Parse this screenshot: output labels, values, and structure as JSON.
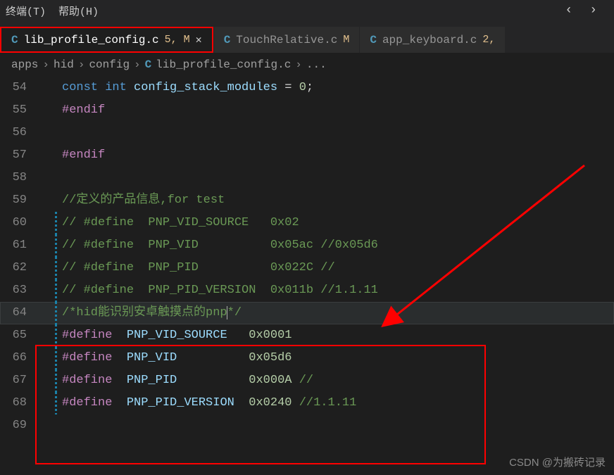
{
  "menu": {
    "terminal": "终端(T)",
    "help": "帮助(H)"
  },
  "tabs": [
    {
      "file": "lib_profile_config.c",
      "badge": "5, M",
      "active": true,
      "closable": true
    },
    {
      "file": "TouchRelative.c",
      "badge": "M",
      "active": false,
      "closable": false
    },
    {
      "file": "app_keyboard.c",
      "badge": "2,",
      "active": false,
      "closable": false
    }
  ],
  "breadcrumbs": {
    "parts": [
      "apps",
      "hid",
      "config"
    ],
    "file": "lib_profile_config.c",
    "tail": "..."
  },
  "lines": [
    {
      "n": "54",
      "mod": false,
      "seg": [
        {
          "c": "kw-const",
          "t": "const "
        },
        {
          "c": "kw-int",
          "t": "int "
        },
        {
          "c": "varname",
          "t": "config_stack_modules"
        },
        {
          "c": "plain",
          "t": " = "
        },
        {
          "c": "num",
          "t": "0"
        },
        {
          "c": "plain",
          "t": ";"
        }
      ]
    },
    {
      "n": "55",
      "mod": false,
      "seg": [
        {
          "c": "kw-pre",
          "t": "#endif"
        }
      ]
    },
    {
      "n": "56",
      "mod": false,
      "seg": []
    },
    {
      "n": "57",
      "mod": false,
      "seg": [
        {
          "c": "kw-pre",
          "t": "#endif"
        }
      ]
    },
    {
      "n": "58",
      "mod": false,
      "seg": []
    },
    {
      "n": "59",
      "mod": false,
      "seg": [
        {
          "c": "cmt",
          "t": "//定义的产品信息,for test"
        }
      ]
    },
    {
      "n": "60",
      "mod": true,
      "seg": [
        {
          "c": "cmt",
          "t": "// #define  PNP_VID_SOURCE   0x02"
        }
      ]
    },
    {
      "n": "61",
      "mod": true,
      "seg": [
        {
          "c": "cmt",
          "t": "// #define  PNP_VID          0x05ac //0x05d6"
        }
      ]
    },
    {
      "n": "62",
      "mod": true,
      "seg": [
        {
          "c": "cmt",
          "t": "// #define  PNP_PID          0x022C //"
        }
      ]
    },
    {
      "n": "63",
      "mod": true,
      "seg": [
        {
          "c": "cmt",
          "t": "// #define  PNP_PID_VERSION  0x011b //1.1.11"
        }
      ]
    },
    {
      "n": "64",
      "mod": true,
      "cur": true,
      "seg": [
        {
          "c": "cmt",
          "t": "/*hid能识别安卓触摸点的pnp"
        },
        {
          "c": "cursor-caret",
          "t": ""
        },
        {
          "c": "cmt",
          "t": "*/"
        }
      ]
    },
    {
      "n": "65",
      "mod": true,
      "seg": [
        {
          "c": "kw-pre",
          "t": "#define"
        },
        {
          "c": "plain",
          "t": "  "
        },
        {
          "c": "def",
          "t": "PNP_VID_SOURCE"
        },
        {
          "c": "plain",
          "t": "   "
        },
        {
          "c": "num",
          "t": "0x0001"
        }
      ]
    },
    {
      "n": "66",
      "mod": true,
      "seg": [
        {
          "c": "kw-pre",
          "t": "#define"
        },
        {
          "c": "plain",
          "t": "  "
        },
        {
          "c": "def",
          "t": "PNP_VID"
        },
        {
          "c": "plain",
          "t": "          "
        },
        {
          "c": "num",
          "t": "0x05d6"
        }
      ]
    },
    {
      "n": "67",
      "mod": true,
      "seg": [
        {
          "c": "kw-pre",
          "t": "#define"
        },
        {
          "c": "plain",
          "t": "  "
        },
        {
          "c": "def",
          "t": "PNP_PID"
        },
        {
          "c": "plain",
          "t": "          "
        },
        {
          "c": "num",
          "t": "0x000A"
        },
        {
          "c": "plain",
          "t": " "
        },
        {
          "c": "cmt",
          "t": "//"
        }
      ]
    },
    {
      "n": "68",
      "mod": true,
      "seg": [
        {
          "c": "kw-pre",
          "t": "#define"
        },
        {
          "c": "plain",
          "t": "  "
        },
        {
          "c": "def",
          "t": "PNP_PID_VERSION"
        },
        {
          "c": "plain",
          "t": "  "
        },
        {
          "c": "num",
          "t": "0x0240"
        },
        {
          "c": "plain",
          "t": " "
        },
        {
          "c": "cmt",
          "t": "//1.1.11"
        }
      ]
    },
    {
      "n": "69",
      "mod": false,
      "seg": []
    }
  ],
  "watermark": "CSDN @为搬砖记录"
}
